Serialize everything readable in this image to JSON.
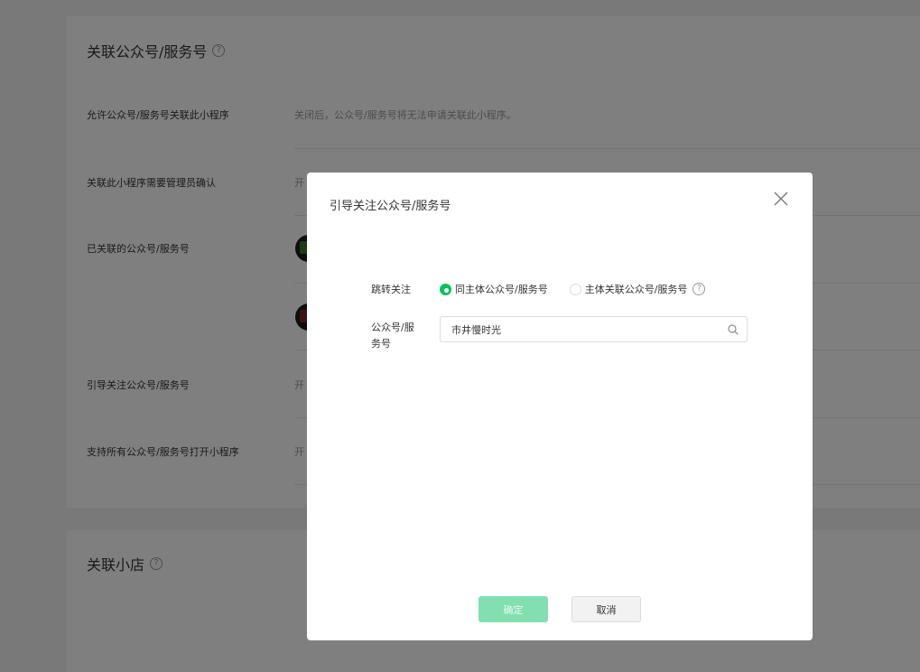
{
  "background": {
    "assoc_section": {
      "title": "关联公众号/服务号",
      "rows": [
        {
          "label": "允许公众号/服务号关联此小程序",
          "value": "关闭后，公众号/服务号将无法申请关联此小程序。"
        },
        {
          "label": "关联此小程序需要管理员确认",
          "value": "开"
        },
        {
          "label": "已关联的公众号/服务号",
          "value": ""
        },
        {
          "label": "引导关注公众号/服务号",
          "value": "开"
        },
        {
          "label": "支持所有公众号/服务号打开小程序",
          "value": "开"
        }
      ]
    },
    "shop_section": {
      "title": "关联小店"
    }
  },
  "dialog": {
    "title": "引导关注公众号/服务号",
    "jump_label": "跳转关注",
    "radio_options": [
      {
        "label": "同主体公众号/服务号",
        "checked": true
      },
      {
        "label": "主体关联公众号/服务号",
        "checked": false
      }
    ],
    "account_label_line1": "公众号/服",
    "account_label_line2": "务号",
    "search_value": "市井慢时光",
    "confirm_label": "确定",
    "cancel_label": "取消"
  },
  "icons": {
    "help": "?",
    "close": "close-icon",
    "search": "search-icon"
  },
  "colors": {
    "accent": "#07c160",
    "accent_disabled": "#82dfb0"
  }
}
